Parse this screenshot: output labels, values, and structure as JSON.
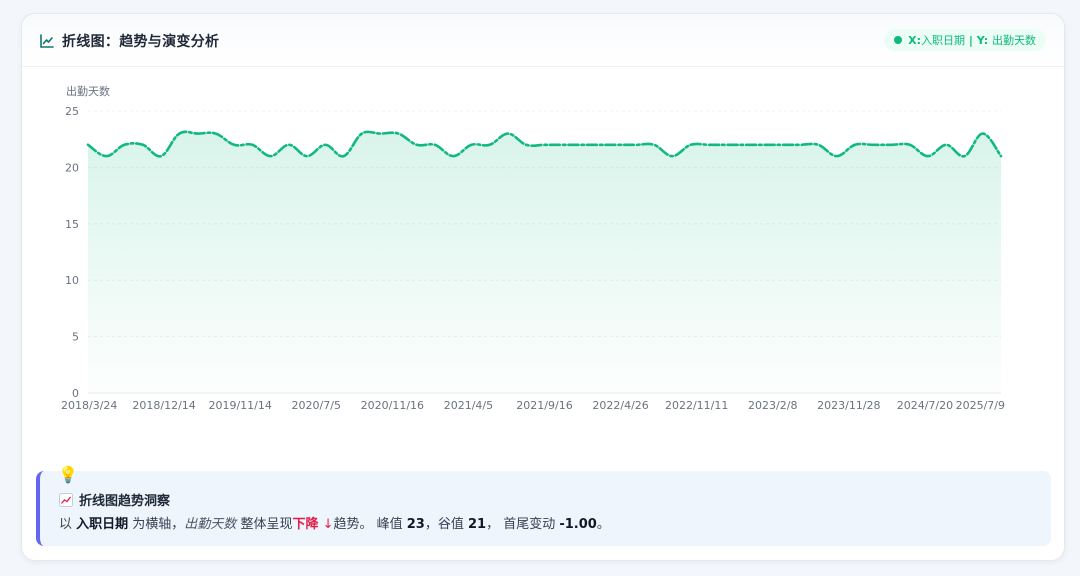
{
  "header": {
    "title": "折线图：趋势与演变分析",
    "badge_x": "X: ",
    "badge_x_value": "入职日期",
    "badge_sep": " | ",
    "badge_y": "Y: ",
    "badge_y_value": "出勤天数"
  },
  "chart_data": {
    "type": "line",
    "ylabel": "出勤天数",
    "xlabel": "",
    "ylim": [
      0,
      25
    ],
    "y_ticks": [
      0,
      5,
      10,
      15,
      20,
      25
    ],
    "grid": true,
    "line_color": "#10b981",
    "fill": true,
    "x_tick_labels": [
      "2018/3/24",
      "2018/12/14",
      "2019/11/14",
      "2020/7/5",
      "2020/11/16",
      "2021/4/5",
      "2021/9/16",
      "2022/4/26",
      "2022/11/11",
      "2023/2/8",
      "2023/11/28",
      "2024/7/20",
      "2025/7/9"
    ],
    "values": [
      22,
      21,
      22,
      22,
      21,
      23,
      23,
      23,
      22,
      22,
      21,
      22,
      21,
      22,
      21,
      23,
      23,
      23,
      22,
      22,
      21,
      22,
      22,
      23,
      22,
      22,
      22,
      22,
      22,
      22,
      22,
      22,
      21,
      22,
      22,
      22,
      22,
      22,
      22,
      22,
      22,
      21,
      22,
      22,
      22,
      22,
      21,
      22,
      21,
      23,
      21
    ]
  },
  "insight": {
    "title": "折线图趋势洞察",
    "p1": "以 ",
    "x_field": "入职日期",
    "p2": " 为横轴，",
    "y_field": "出勤天数",
    "p3": " 整体呈现",
    "trend": "下降",
    "arrow": " ↓",
    "p4": "趋势。 峰值 ",
    "peak": "23",
    "p5": "，谷值 ",
    "valley": "21",
    "p6": "， 首尾变动 ",
    "change": "-1.00",
    "p7": "。"
  },
  "colors": {
    "accent": "#10b981",
    "insight_border": "#6366f1",
    "trend_down": "#e11d48"
  },
  "icons": {
    "title": "line-chart-icon",
    "insight_top": "lightbulb-icon",
    "insight_title": "chart-increasing-icon"
  }
}
